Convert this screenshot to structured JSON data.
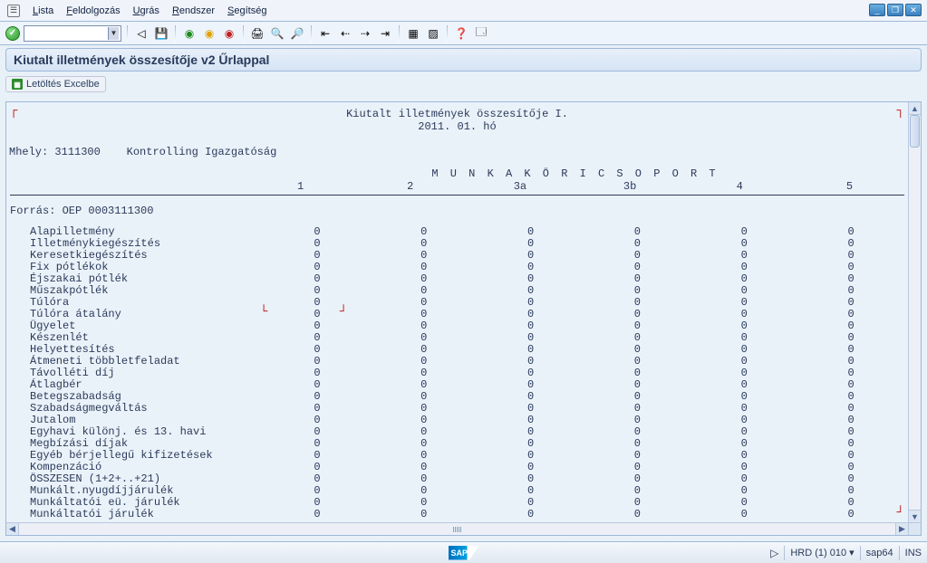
{
  "window": {
    "min": "_",
    "max": "❐",
    "close": "✕"
  },
  "menu": {
    "icon_glyph": "☰",
    "items": [
      {
        "pre": "L",
        "rest": "ista"
      },
      {
        "pre": "F",
        "rest": "eldolgozás"
      },
      {
        "pre": "U",
        "rest": "grás"
      },
      {
        "pre": "R",
        "rest": "endszer"
      },
      {
        "pre": "S",
        "rest": "egítség"
      }
    ]
  },
  "toolbar": {
    "check": "✓",
    "back_glyph": "◁",
    "save_glyph": "💾",
    "nav": {
      "ok": "◉",
      "cancel": "◉",
      "stop": "◉"
    },
    "doc_glyph": "🖨",
    "find_glyph": "🔍",
    "find2_glyph": "🔎",
    "set1": [
      "⇤",
      "⇠",
      "⇢",
      "⇥"
    ],
    "set2": [
      "▦",
      "▨"
    ],
    "help_glyph": "❓",
    "cust_glyph": "🗔"
  },
  "title": "Kiutalt illetmények összesítője v2 Űrlappal",
  "action": {
    "label": "Letöltés Excelbe"
  },
  "content": {
    "header1": "Kiutalt illetmények összesítője I.",
    "header2": "2011. 01. hó",
    "mhely_label": "Mhely:",
    "mhely_code": "3111300",
    "mhely_name": "Kontrolling Igazgatóság",
    "group_title": "M U N K A K Ö R I    C S O P O R T",
    "columns": [
      "1",
      "2",
      "3a",
      "3b",
      "4",
      "5"
    ],
    "forras": "Forrás: OEP 0003111300",
    "rows": [
      {
        "label": "Alapilletmény",
        "v": [
          0,
          0,
          0,
          0,
          0,
          0
        ]
      },
      {
        "label": "Illetménykiegészítés",
        "v": [
          0,
          0,
          0,
          0,
          0,
          0
        ]
      },
      {
        "label": "Keresetkiegészítés",
        "v": [
          0,
          0,
          0,
          0,
          0,
          0
        ]
      },
      {
        "label": "Fix pótlékok",
        "v": [
          0,
          0,
          0,
          0,
          0,
          0
        ]
      },
      {
        "label": "Éjszakai pótlék",
        "v": [
          0,
          0,
          0,
          0,
          0,
          0
        ]
      },
      {
        "label": "Műszakpótlék",
        "v": [
          0,
          0,
          0,
          0,
          0,
          0
        ]
      },
      {
        "label": "Túlóra",
        "v": [
          0,
          0,
          0,
          0,
          0,
          0
        ]
      },
      {
        "label": "Túlóra átalány",
        "v": [
          0,
          0,
          0,
          0,
          0,
          0
        ]
      },
      {
        "label": "Ügyelet",
        "v": [
          0,
          0,
          0,
          0,
          0,
          0
        ]
      },
      {
        "label": "Készenlét",
        "v": [
          0,
          0,
          0,
          0,
          0,
          0
        ]
      },
      {
        "label": "Helyettesítés",
        "v": [
          0,
          0,
          0,
          0,
          0,
          0
        ]
      },
      {
        "label": "Átmeneti többletfeladat",
        "v": [
          0,
          0,
          0,
          0,
          0,
          0
        ]
      },
      {
        "label": "Távolléti díj",
        "v": [
          0,
          0,
          0,
          0,
          0,
          0
        ]
      },
      {
        "label": "Átlagbér",
        "v": [
          0,
          0,
          0,
          0,
          0,
          0
        ]
      },
      {
        "label": "Betegszabadság",
        "v": [
          0,
          0,
          0,
          0,
          0,
          0
        ]
      },
      {
        "label": "Szabadságmegváltás",
        "v": [
          0,
          0,
          0,
          0,
          0,
          0
        ]
      },
      {
        "label": "Jutalom",
        "v": [
          0,
          0,
          0,
          0,
          0,
          0
        ]
      },
      {
        "label": "Egyhavi különj. és 13. havi",
        "v": [
          0,
          0,
          0,
          0,
          0,
          0
        ]
      },
      {
        "label": "Megbízási díjak",
        "v": [
          0,
          0,
          0,
          0,
          0,
          0
        ]
      },
      {
        "label": "Egyéb bérjellegű kifizetések",
        "v": [
          0,
          0,
          0,
          0,
          0,
          0
        ]
      },
      {
        "label": "Kompenzáció",
        "v": [
          0,
          0,
          0,
          0,
          0,
          0
        ]
      },
      {
        "label": "ÖSSZESEN (1+2+..+21)",
        "v": [
          0,
          0,
          0,
          0,
          0,
          0
        ]
      },
      {
        "label": "Munkált.nyugdíjjárulék",
        "v": [
          0,
          0,
          0,
          0,
          0,
          0
        ]
      },
      {
        "label": "Munkáltatói eü. járulék",
        "v": [
          0,
          0,
          0,
          0,
          0,
          0
        ]
      },
      {
        "label": "Munkáltatói járulék",
        "v": [
          0,
          0,
          0,
          0,
          0,
          0
        ]
      }
    ]
  },
  "status": {
    "nav_glyph": "▷",
    "client": "HRD (1) 010",
    "dd": "▾",
    "server": "sap64",
    "ins": "INS"
  }
}
